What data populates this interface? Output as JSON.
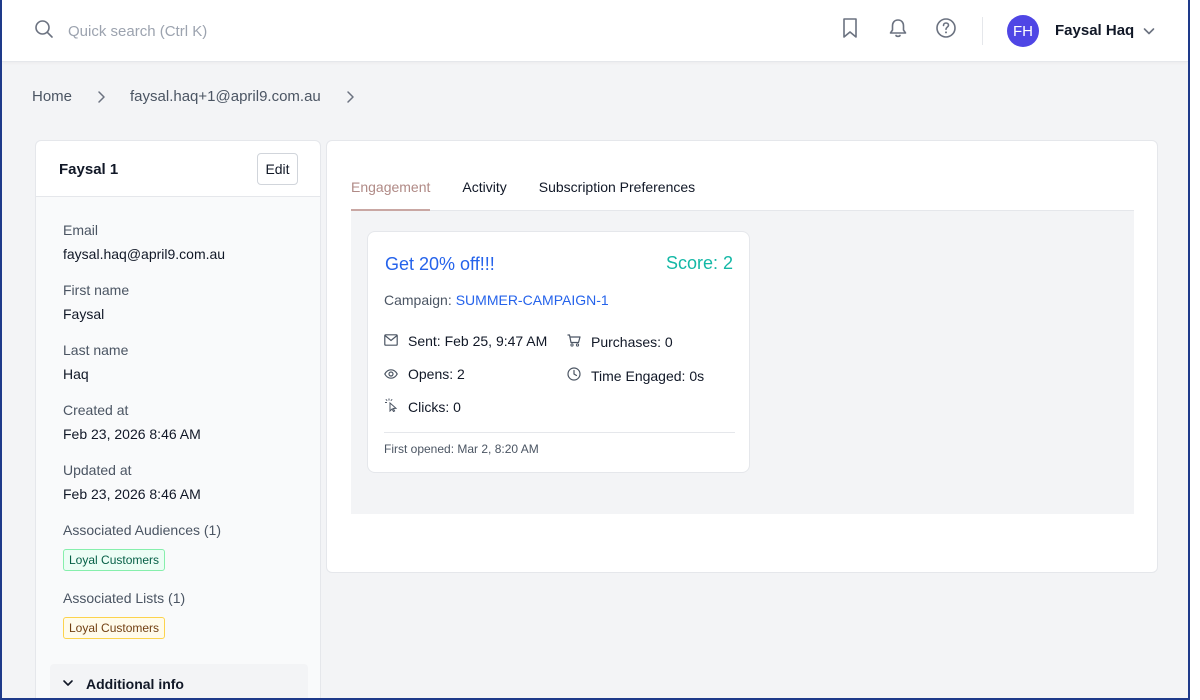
{
  "header": {
    "search_placeholder": "Quick search (Ctrl K)",
    "user_initials": "FH",
    "user_name": "Faysal Haq"
  },
  "breadcrumb": {
    "home": "Home",
    "contact": "faysal.haq+1@april9.com.au"
  },
  "contact_panel": {
    "title": "Faysal 1",
    "edit_label": "Edit",
    "fields": {
      "email_label": "Email",
      "email_value": "faysal.haq@april9.com.au",
      "first_name_label": "First name",
      "first_name_value": "Faysal",
      "last_name_label": "Last name",
      "last_name_value": "Haq",
      "created_label": "Created at",
      "created_value": "Feb 23, 2026 8:46 AM",
      "updated_label": "Updated at",
      "updated_value": "Feb 23, 2026 8:46 AM",
      "audiences_label": "Associated Audiences (1)",
      "audience_tag": "Loyal Customers",
      "lists_label": "Associated Lists (1)",
      "list_tag": "Loyal Customers"
    },
    "additional_info_label": "Additional info"
  },
  "tabs": [
    {
      "label": "Engagement",
      "active": true
    },
    {
      "label": "Activity",
      "active": false
    },
    {
      "label": "Subscription Preferences",
      "active": false
    }
  ],
  "engagement_card": {
    "title": "Get 20% off!!!",
    "score": "Score: 2",
    "campaign_label": "Campaign:",
    "campaign_name": "SUMMER-CAMPAIGN-1",
    "sent": "Sent: Feb 25, 9:47 AM",
    "opens": "Opens: 2",
    "clicks": "Clicks: 0",
    "purchases": "Purchases: 0",
    "time_engaged": "Time Engaged: 0s",
    "first_opened": "First opened: Mar 2, 8:20 AM"
  },
  "colors": {
    "accent_blue": "#2563eb",
    "score_teal": "#14b8a6",
    "avatar_bg": "#4f46e5",
    "active_tab": "#b08a86"
  }
}
